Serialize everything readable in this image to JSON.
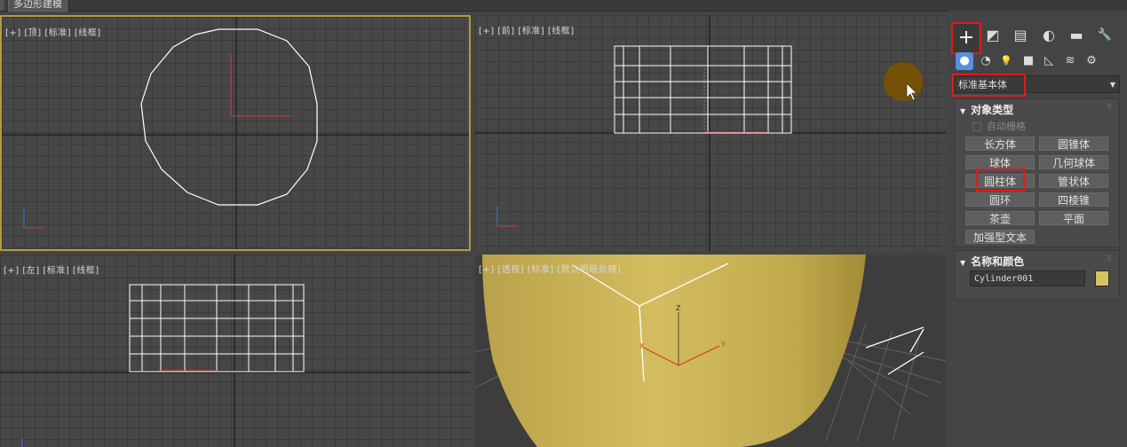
{
  "top": {
    "tab_label": "多边形建模"
  },
  "viewports": {
    "top": {
      "label": "[+] [顶] [标准] [线框]"
    },
    "front": {
      "label": "[+] [前] [标准] [线框]"
    },
    "left": {
      "label": "[+] [左] [标准] [线框]"
    },
    "perspective": {
      "label": "[+] [透视] [标准] [默认明暗处理]",
      "axis_z": "Z",
      "axis_x": "X",
      "axis_y": "Y"
    }
  },
  "panel": {
    "tabs": [
      {
        "icon": "create-icon",
        "glyph": "+"
      },
      {
        "icon": "modify-icon",
        "glyph": "◩"
      },
      {
        "icon": "hierarchy-icon",
        "glyph": "▤"
      },
      {
        "icon": "motion-icon",
        "glyph": "◐"
      },
      {
        "icon": "display-icon",
        "glyph": "▬"
      },
      {
        "icon": "utilities-icon",
        "glyph": "🔧"
      }
    ],
    "subcategories": [
      {
        "icon": "geometry-icon",
        "glyph": "●"
      },
      {
        "icon": "shapes-icon",
        "glyph": "◔"
      },
      {
        "icon": "lights-icon",
        "glyph": "💡"
      },
      {
        "icon": "cameras-icon",
        "glyph": "■"
      },
      {
        "icon": "helpers-icon",
        "glyph": "◺"
      },
      {
        "icon": "spacewarps-icon",
        "glyph": "≋"
      },
      {
        "icon": "systems-icon",
        "glyph": "⚙"
      }
    ],
    "dropdown": {
      "value": "标准基本体"
    },
    "object_type": {
      "title": "对象类型",
      "autogrid": "自动栅格",
      "buttons": [
        "长方体",
        "圆锥体",
        "球体",
        "几何球体",
        "圆柱体",
        "管状体",
        "圆环",
        "四棱锥",
        "茶壶",
        "平面",
        "加强型文本"
      ]
    },
    "name_color": {
      "title": "名称和颜色",
      "name": "Cylinder001",
      "color": "#d9c160"
    }
  },
  "colors": {
    "highlight": "#e21a1a",
    "active_viewport": "#b49a45",
    "object": "#c9b152"
  }
}
